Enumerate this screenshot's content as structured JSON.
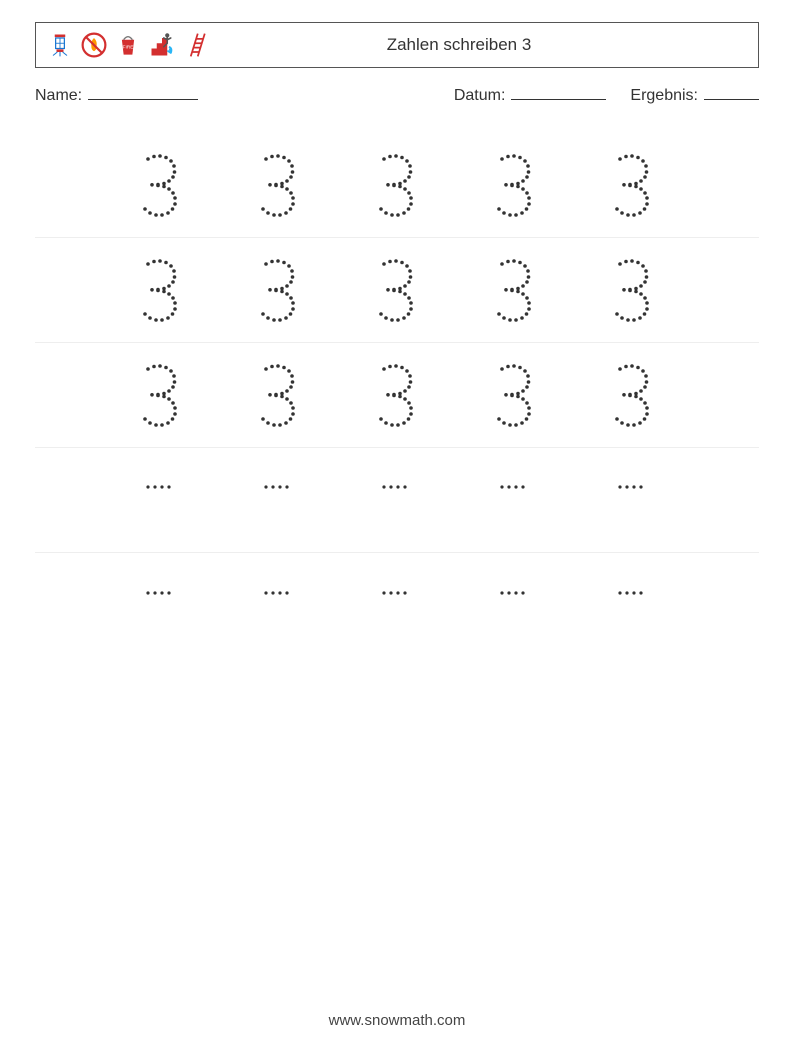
{
  "header": {
    "title": "Zahlen schreiben 3",
    "icons": [
      "lantern-icon",
      "no-fire-icon",
      "fire-bucket-icon",
      "exit-stairs-icon",
      "ladder-icon"
    ]
  },
  "meta": {
    "name_label": "Name:",
    "date_label": "Datum:",
    "result_label": "Ergebnis:"
  },
  "grid": {
    "rows": 5,
    "cols": 5,
    "cells": [
      [
        "3",
        "3",
        "3",
        "3",
        "3"
      ],
      [
        "3",
        "3",
        "3",
        "3",
        "3"
      ],
      [
        "3",
        "3",
        "3",
        "3",
        "3"
      ],
      [
        "dots",
        "dots",
        "dots",
        "dots",
        "dots"
      ],
      [
        "dots",
        "dots",
        "dots",
        "dots",
        "dots"
      ]
    ]
  },
  "footer": {
    "url": "www.snowmath.com"
  }
}
